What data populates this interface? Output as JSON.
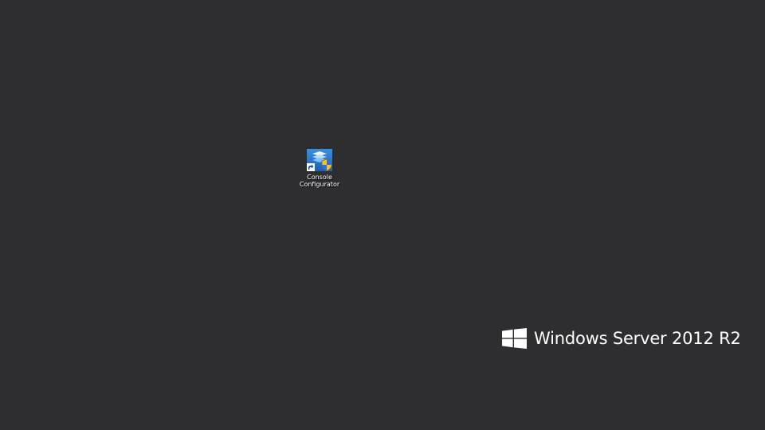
{
  "desktop": {
    "background_color": "#2e2d30",
    "icons": [
      {
        "label": "Console\nConfigurator",
        "icon": "console-configurator-icon",
        "shortcut_overlay": "shortcut-arrow-icon",
        "badge": "uac-shield-icon"
      }
    ]
  },
  "branding": {
    "logo": "windows-logo-icon",
    "text": "Windows Server 2012 R2"
  }
}
